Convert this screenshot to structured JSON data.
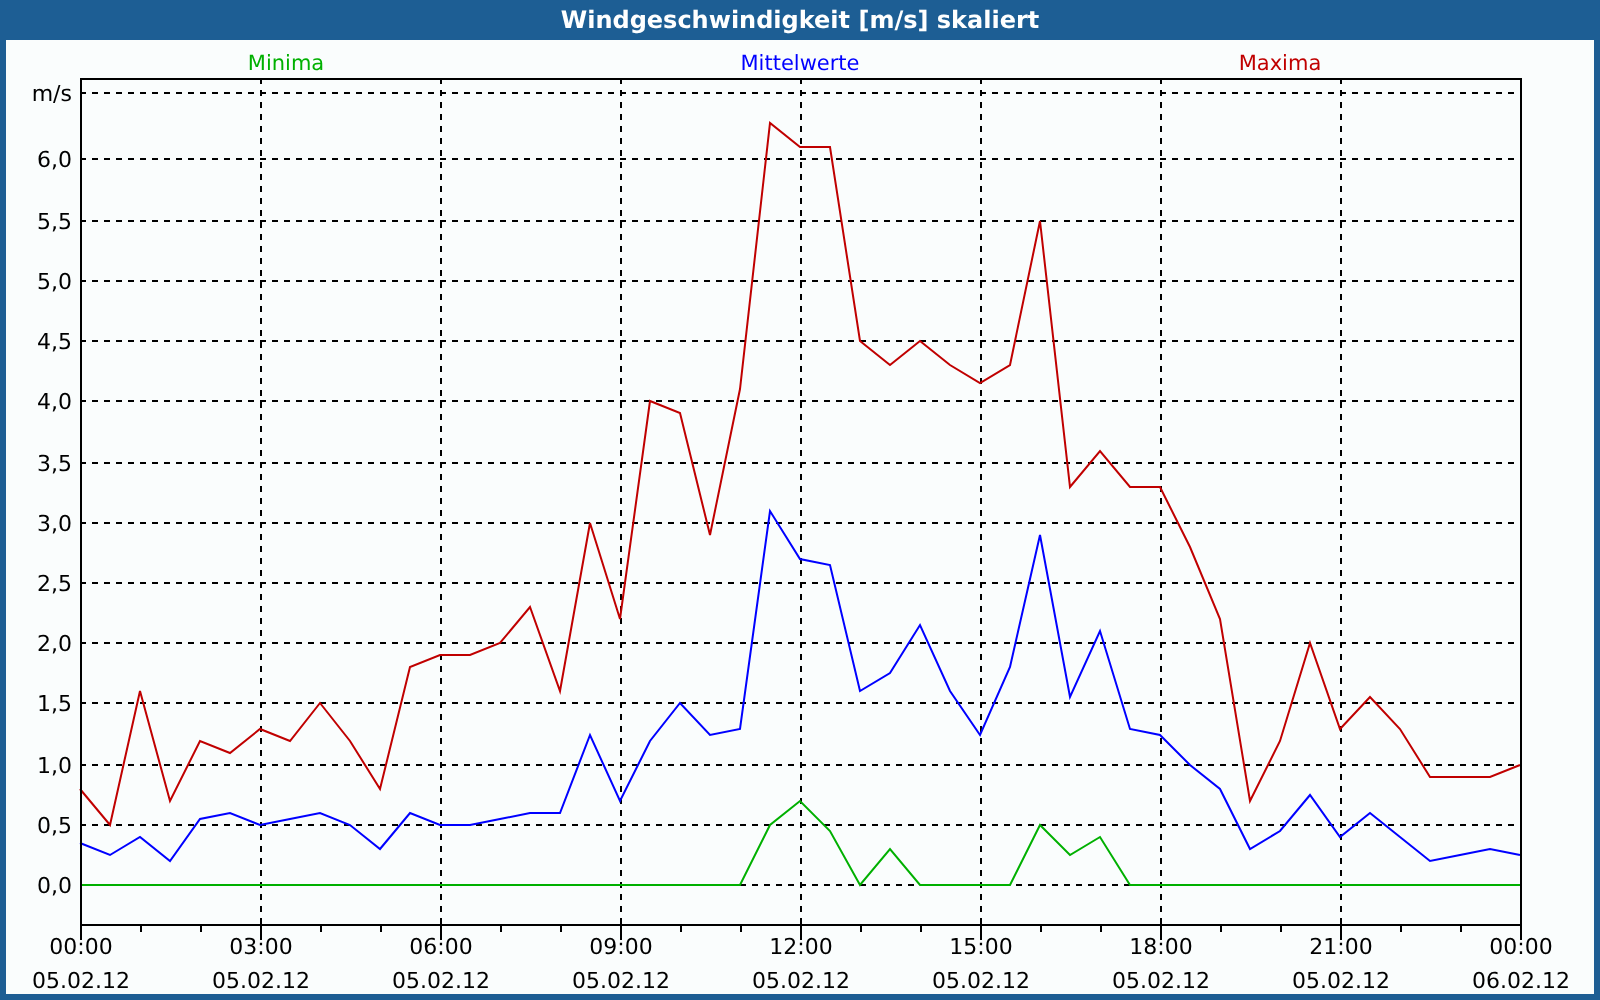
{
  "window": {
    "title": "Windgeschwindigkeit [m/s] skaliert"
  },
  "chart": {
    "chart_data": {
      "type": "line",
      "ylabel": "m/s",
      "categories": [
        "00:00\n05.02.12",
        null,
        null,
        null,
        null,
        null,
        "03:00\n05.02.12",
        null,
        null,
        null,
        null,
        null,
        "06:00\n05.02.12",
        null,
        null,
        null,
        null,
        null,
        "09:00\n05.02.12",
        null,
        null,
        null,
        null,
        null,
        "12:00\n05.02.12",
        null,
        null,
        null,
        null,
        null,
        "15:00\n05.02.12",
        null,
        null,
        null,
        null,
        null,
        "18:00\n05.02.12",
        null,
        null,
        null,
        null,
        null,
        "21:00\n05.02.12",
        null,
        null,
        null,
        null,
        null,
        "00:00\n06.02.12"
      ],
      "series": [
        {
          "name": "Minima",
          "color": "#00b000",
          "values": [
            0,
            0,
            0,
            0,
            0,
            0,
            0,
            0,
            0,
            0,
            0,
            0,
            0,
            0,
            0,
            0,
            0,
            0,
            0,
            0,
            0,
            0,
            0,
            0.5,
            0.7,
            0.45,
            0,
            0.3,
            0,
            0,
            0,
            0,
            0.5,
            0.25,
            0.4,
            0,
            0,
            0,
            0,
            0,
            0,
            0,
            0,
            0,
            0,
            0,
            0,
            0,
            0
          ]
        },
        {
          "name": "Mittelwerte",
          "color": "#0000ff",
          "values": [
            0.35,
            0.25,
            0.4,
            0.2,
            0.55,
            0.6,
            0.5,
            0.55,
            0.6,
            0.5,
            0.3,
            0.6,
            0.5,
            0.5,
            0.55,
            0.6,
            0.6,
            1.25,
            0.7,
            1.2,
            1.5,
            1.25,
            1.3,
            3.1,
            2.7,
            2.65,
            1.6,
            1.75,
            2.15,
            1.6,
            1.25,
            1.8,
            2.9,
            1.55,
            2.1,
            1.3,
            1.25,
            1.0,
            0.8,
            0.3,
            0.45,
            0.75,
            0.4,
            0.6,
            0.4,
            0.2,
            0.25,
            0.3,
            0.25
          ]
        },
        {
          "name": "Maxima",
          "color": "#c00000",
          "values": [
            0.8,
            0.5,
            1.6,
            0.7,
            1.2,
            1.1,
            1.3,
            1.2,
            1.5,
            1.2,
            0.8,
            1.8,
            1.9,
            1.9,
            2.0,
            2.3,
            1.6,
            3.0,
            2.2,
            4.0,
            3.9,
            2.9,
            4.1,
            6.3,
            6.1,
            6.1,
            4.5,
            4.3,
            4.5,
            4.3,
            4.15,
            4.3,
            5.5,
            3.3,
            3.6,
            3.3,
            3.3,
            2.8,
            2.2,
            0.7,
            1.2,
            2.0,
            1.3,
            1.55,
            1.3,
            0.9,
            0.9,
            0.9,
            1.0
          ]
        }
      ],
      "ylim": [
        -0.33,
        6.67
      ],
      "grid": true,
      "yticks": [
        {
          "value": 0,
          "label": "0,0"
        },
        {
          "value": 0.5,
          "label": "0,5"
        },
        {
          "value": 1,
          "label": "1,0"
        },
        {
          "value": 1.5,
          "label": "1,5"
        },
        {
          "value": 2,
          "label": "2,0"
        },
        {
          "value": 2.5,
          "label": "2,5"
        },
        {
          "value": 3,
          "label": "3,0"
        },
        {
          "value": 3.5,
          "label": "3,5"
        },
        {
          "value": 4,
          "label": "4,0"
        },
        {
          "value": 4.5,
          "label": "4,5"
        },
        {
          "value": 5,
          "label": "5,0"
        },
        {
          "value": 5.5,
          "label": "5,5"
        },
        {
          "value": 6,
          "label": "6,0"
        }
      ]
    }
  }
}
